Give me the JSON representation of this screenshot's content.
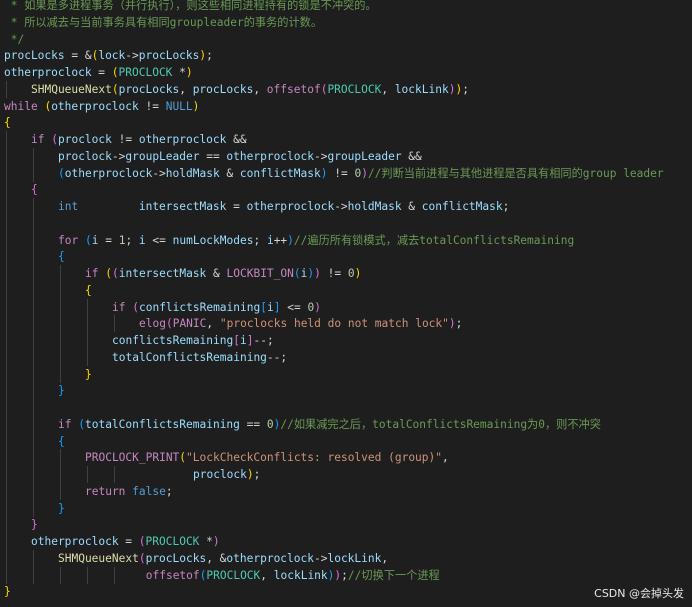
{
  "watermark": "CSDN @会掉头发",
  "code_lines": [
    {
      "indent": 0,
      "tokens": [
        {
          "t": " * 如果是多进程事务（并行执行），则这些相同进程持有的锁是不冲突的。",
          "c": "cm"
        }
      ]
    },
    {
      "indent": 0,
      "tokens": [
        {
          "t": " * 所以减去与当前事务具有相同groupleader的事务的计数。",
          "c": "cm"
        }
      ]
    },
    {
      "indent": 0,
      "tokens": [
        {
          "t": " */",
          "c": "cm"
        }
      ]
    },
    {
      "indent": 0,
      "tokens": [
        {
          "t": "procLocks",
          "c": "var"
        },
        {
          "t": " = &",
          "c": "op"
        },
        {
          "t": "(",
          "c": "br1"
        },
        {
          "t": "lock",
          "c": "var"
        },
        {
          "t": "->",
          "c": "op"
        },
        {
          "t": "procLocks",
          "c": "var"
        },
        {
          "t": ")",
          "c": "br1"
        },
        {
          "t": ";",
          "c": "op"
        }
      ]
    },
    {
      "indent": 0,
      "tokens": [
        {
          "t": "otherproclock",
          "c": "var"
        },
        {
          "t": " = ",
          "c": "op"
        },
        {
          "t": "(",
          "c": "br1"
        },
        {
          "t": "PROCLOCK",
          "c": "ty"
        },
        {
          "t": " *",
          "c": "op"
        },
        {
          "t": ")",
          "c": "br1"
        }
      ]
    },
    {
      "indent": 4,
      "tokens": [
        {
          "t": "SHMQueueNext",
          "c": "fn"
        },
        {
          "t": "(",
          "c": "br1"
        },
        {
          "t": "procLocks",
          "c": "var"
        },
        {
          "t": ", ",
          "c": "op"
        },
        {
          "t": "procLocks",
          "c": "var"
        },
        {
          "t": ", ",
          "c": "op"
        },
        {
          "t": "offsetof",
          "c": "mac"
        },
        {
          "t": "(",
          "c": "br2"
        },
        {
          "t": "PROCLOCK",
          "c": "ty"
        },
        {
          "t": ", ",
          "c": "op"
        },
        {
          "t": "lockLink",
          "c": "var"
        },
        {
          "t": ")",
          "c": "br2"
        },
        {
          "t": ")",
          "c": "br1"
        },
        {
          "t": ";",
          "c": "op"
        }
      ]
    },
    {
      "indent": 0,
      "tokens": [
        {
          "t": "while",
          "c": "ctl"
        },
        {
          "t": " ",
          "c": "op"
        },
        {
          "t": "(",
          "c": "br1"
        },
        {
          "t": "otherproclock",
          "c": "var"
        },
        {
          "t": " != ",
          "c": "op"
        },
        {
          "t": "NULL",
          "c": "kw"
        },
        {
          "t": ")",
          "c": "br1"
        }
      ]
    },
    {
      "indent": 0,
      "tokens": [
        {
          "t": "{",
          "c": "br1"
        }
      ]
    },
    {
      "indent": 4,
      "tokens": [
        {
          "t": "if",
          "c": "ctl"
        },
        {
          "t": " ",
          "c": "op"
        },
        {
          "t": "(",
          "c": "br2"
        },
        {
          "t": "proclock",
          "c": "var"
        },
        {
          "t": " != ",
          "c": "op"
        },
        {
          "t": "otherproclock",
          "c": "var"
        },
        {
          "t": " &&",
          "c": "op"
        }
      ]
    },
    {
      "indent": 8,
      "tokens": [
        {
          "t": "proclock",
          "c": "var"
        },
        {
          "t": "->",
          "c": "op"
        },
        {
          "t": "groupLeader",
          "c": "var"
        },
        {
          "t": " == ",
          "c": "op"
        },
        {
          "t": "otherproclock",
          "c": "var"
        },
        {
          "t": "->",
          "c": "op"
        },
        {
          "t": "groupLeader",
          "c": "var"
        },
        {
          "t": " &&",
          "c": "op"
        }
      ]
    },
    {
      "indent": 8,
      "tokens": [
        {
          "t": "(",
          "c": "br3"
        },
        {
          "t": "otherproclock",
          "c": "var"
        },
        {
          "t": "->",
          "c": "op"
        },
        {
          "t": "holdMask",
          "c": "var"
        },
        {
          "t": " & ",
          "c": "op"
        },
        {
          "t": "conflictMask",
          "c": "var"
        },
        {
          "t": ")",
          "c": "br3"
        },
        {
          "t": " != ",
          "c": "op"
        },
        {
          "t": "0",
          "c": "num"
        },
        {
          "t": ")",
          "c": "br2"
        },
        {
          "t": "//判断当前进程与其他进程是否具有相同的group leader",
          "c": "cm"
        }
      ]
    },
    {
      "indent": 4,
      "tokens": [
        {
          "t": "{",
          "c": "br2"
        }
      ]
    },
    {
      "indent": 8,
      "tokens": [
        {
          "t": "int",
          "c": "kw"
        },
        {
          "t": "         ",
          "c": "op"
        },
        {
          "t": "intersectMask",
          "c": "var"
        },
        {
          "t": " = ",
          "c": "op"
        },
        {
          "t": "otherproclock",
          "c": "var"
        },
        {
          "t": "->",
          "c": "op"
        },
        {
          "t": "holdMask",
          "c": "var"
        },
        {
          "t": " & ",
          "c": "op"
        },
        {
          "t": "conflictMask",
          "c": "var"
        },
        {
          "t": ";",
          "c": "op"
        }
      ]
    },
    {
      "indent": 8,
      "tokens": []
    },
    {
      "indent": 8,
      "tokens": [
        {
          "t": "for",
          "c": "ctl"
        },
        {
          "t": " ",
          "c": "op"
        },
        {
          "t": "(",
          "c": "br3"
        },
        {
          "t": "i",
          "c": "var"
        },
        {
          "t": " = ",
          "c": "op"
        },
        {
          "t": "1",
          "c": "num"
        },
        {
          "t": "; ",
          "c": "op"
        },
        {
          "t": "i",
          "c": "var"
        },
        {
          "t": " <= ",
          "c": "op"
        },
        {
          "t": "numLockModes",
          "c": "var"
        },
        {
          "t": "; ",
          "c": "op"
        },
        {
          "t": "i",
          "c": "var"
        },
        {
          "t": "++",
          "c": "op"
        },
        {
          "t": ")",
          "c": "br3"
        },
        {
          "t": "//遍历所有锁模式，减去totalConflictsRemaining",
          "c": "cm"
        }
      ]
    },
    {
      "indent": 8,
      "tokens": [
        {
          "t": "{",
          "c": "br3"
        }
      ]
    },
    {
      "indent": 12,
      "tokens": [
        {
          "t": "if",
          "c": "ctl"
        },
        {
          "t": " ",
          "c": "op"
        },
        {
          "t": "(",
          "c": "br1"
        },
        {
          "t": "(",
          "c": "br2"
        },
        {
          "t": "intersectMask",
          "c": "var"
        },
        {
          "t": " & ",
          "c": "op"
        },
        {
          "t": "LOCKBIT_ON",
          "c": "mac"
        },
        {
          "t": "(",
          "c": "br3"
        },
        {
          "t": "i",
          "c": "var"
        },
        {
          "t": ")",
          "c": "br3"
        },
        {
          "t": ")",
          "c": "br2"
        },
        {
          "t": " != ",
          "c": "op"
        },
        {
          "t": "0",
          "c": "num"
        },
        {
          "t": ")",
          "c": "br1"
        }
      ]
    },
    {
      "indent": 12,
      "tokens": [
        {
          "t": "{",
          "c": "br1"
        }
      ]
    },
    {
      "indent": 16,
      "tokens": [
        {
          "t": "if",
          "c": "ctl"
        },
        {
          "t": " ",
          "c": "op"
        },
        {
          "t": "(",
          "c": "br2"
        },
        {
          "t": "conflictsRemaining",
          "c": "var"
        },
        {
          "t": "[",
          "c": "br3"
        },
        {
          "t": "i",
          "c": "var"
        },
        {
          "t": "]",
          "c": "br3"
        },
        {
          "t": " <= ",
          "c": "op"
        },
        {
          "t": "0",
          "c": "num"
        },
        {
          "t": ")",
          "c": "br2"
        }
      ]
    },
    {
      "indent": 20,
      "tokens": [
        {
          "t": "elog",
          "c": "mac"
        },
        {
          "t": "(",
          "c": "br2"
        },
        {
          "t": "PANIC",
          "c": "mac"
        },
        {
          "t": ", ",
          "c": "op"
        },
        {
          "t": "\"proclocks held do not match lock\"",
          "c": "str"
        },
        {
          "t": ")",
          "c": "br2"
        },
        {
          "t": ";",
          "c": "op"
        }
      ]
    },
    {
      "indent": 16,
      "tokens": [
        {
          "t": "conflictsRemaining",
          "c": "var"
        },
        {
          "t": "[",
          "c": "br2"
        },
        {
          "t": "i",
          "c": "var"
        },
        {
          "t": "]",
          "c": "br2"
        },
        {
          "t": "--;",
          "c": "op"
        }
      ]
    },
    {
      "indent": 16,
      "tokens": [
        {
          "t": "totalConflictsRemaining",
          "c": "var"
        },
        {
          "t": "--;",
          "c": "op"
        }
      ]
    },
    {
      "indent": 12,
      "tokens": [
        {
          "t": "}",
          "c": "br1"
        }
      ]
    },
    {
      "indent": 8,
      "tokens": [
        {
          "t": "}",
          "c": "br3"
        }
      ]
    },
    {
      "indent": 8,
      "tokens": []
    },
    {
      "indent": 8,
      "tokens": [
        {
          "t": "if",
          "c": "ctl"
        },
        {
          "t": " ",
          "c": "op"
        },
        {
          "t": "(",
          "c": "br3"
        },
        {
          "t": "totalConflictsRemaining",
          "c": "var"
        },
        {
          "t": " == ",
          "c": "op"
        },
        {
          "t": "0",
          "c": "num"
        },
        {
          "t": ")",
          "c": "br3"
        },
        {
          "t": "//如果减完之后，totalConflictsRemaining为0，则不冲突",
          "c": "cm"
        }
      ]
    },
    {
      "indent": 8,
      "tokens": [
        {
          "t": "{",
          "c": "br3"
        }
      ]
    },
    {
      "indent": 12,
      "tokens": [
        {
          "t": "PROCLOCK_PRINT",
          "c": "mac"
        },
        {
          "t": "(",
          "c": "br1"
        },
        {
          "t": "\"LockCheckConflicts: resolved (group)\"",
          "c": "str"
        },
        {
          "t": ",",
          "c": "op"
        }
      ]
    },
    {
      "indent": 28,
      "tokens": [
        {
          "t": "proclock",
          "c": "var"
        },
        {
          "t": ")",
          "c": "br1"
        },
        {
          "t": ";",
          "c": "op"
        }
      ]
    },
    {
      "indent": 12,
      "tokens": [
        {
          "t": "return",
          "c": "ctl"
        },
        {
          "t": " ",
          "c": "op"
        },
        {
          "t": "false",
          "c": "kw"
        },
        {
          "t": ";",
          "c": "op"
        }
      ]
    },
    {
      "indent": 8,
      "tokens": [
        {
          "t": "}",
          "c": "br3"
        }
      ]
    },
    {
      "indent": 4,
      "tokens": [
        {
          "t": "}",
          "c": "br2"
        }
      ]
    },
    {
      "indent": 4,
      "tokens": [
        {
          "t": "otherproclock",
          "c": "var"
        },
        {
          "t": " = ",
          "c": "op"
        },
        {
          "t": "(",
          "c": "br2"
        },
        {
          "t": "PROCLOCK",
          "c": "ty"
        },
        {
          "t": " *",
          "c": "op"
        },
        {
          "t": ")",
          "c": "br2"
        }
      ]
    },
    {
      "indent": 8,
      "tokens": [
        {
          "t": "SHMQueueNext",
          "c": "fn"
        },
        {
          "t": "(",
          "c": "br2"
        },
        {
          "t": "procLocks",
          "c": "var"
        },
        {
          "t": ", &",
          "c": "op"
        },
        {
          "t": "otherproclock",
          "c": "var"
        },
        {
          "t": "->",
          "c": "op"
        },
        {
          "t": "lockLink",
          "c": "var"
        },
        {
          "t": ",",
          "c": "op"
        }
      ]
    },
    {
      "indent": 21,
      "tokens": [
        {
          "t": "offsetof",
          "c": "mac"
        },
        {
          "t": "(",
          "c": "br3"
        },
        {
          "t": "PROCLOCK",
          "c": "ty"
        },
        {
          "t": ", ",
          "c": "op"
        },
        {
          "t": "lockLink",
          "c": "var"
        },
        {
          "t": ")",
          "c": "br3"
        },
        {
          "t": ")",
          "c": "br2"
        },
        {
          "t": ";",
          "c": "op"
        },
        {
          "t": "//切换下一个进程",
          "c": "cm"
        }
      ]
    },
    {
      "indent": 0,
      "tokens": [
        {
          "t": "}",
          "c": "br1"
        }
      ]
    }
  ]
}
